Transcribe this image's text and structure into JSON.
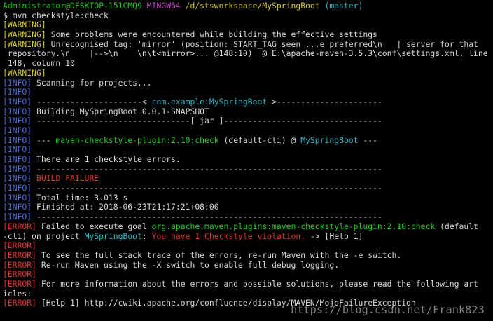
{
  "terminal": {
    "colors": {
      "background": "#000000",
      "default": "#d8d8d8",
      "green": "#1fd01f",
      "magenta": "#d04ad0",
      "yellow": "#d8c838",
      "cyan": "#30b8c8",
      "blue": "#4a6ad8",
      "red": "#e0352a"
    },
    "lines": [
      [
        [
          "green",
          "Administrator@DESKTOP-151CMQ9 "
        ],
        [
          "magenta",
          "MINGW64 "
        ],
        [
          "yellow",
          "/d/stsworkspace/MySpringBoot "
        ],
        [
          "cyan",
          "(master)"
        ]
      ],
      [
        [
          "default",
          "$ mvn checkstyle:check"
        ]
      ],
      [
        [
          "yellow",
          "[WARNING]"
        ]
      ],
      [
        [
          "yellow",
          "[WARNING]"
        ],
        [
          "default",
          " Some problems were encountered while building the effective settings"
        ]
      ],
      [
        [
          "yellow",
          "[WARNING]"
        ],
        [
          "default",
          " Unrecognised tag: 'mirror' (position: START_TAG seen ...e preferred\\n   | server for that"
        ]
      ],
      [
        [
          "default",
          " repository.\\n    |-->\\n    \\n\\t<mirror>... @148:10)  @ E:\\apache-maven-3.5.3\\conf\\settings.xml, line"
        ]
      ],
      [
        [
          "default",
          " 148, column 10"
        ]
      ],
      [
        [
          "yellow",
          "[WARNING]"
        ]
      ],
      [
        [
          "blue",
          "[INFO]"
        ],
        [
          "default",
          " Scanning for projects..."
        ]
      ],
      [
        [
          "blue",
          "[INFO]"
        ]
      ],
      [
        [
          "blue",
          "[INFO]"
        ],
        [
          "default",
          " ----------------------< "
        ],
        [
          "cyan",
          "com.example:MySpringBoot"
        ],
        [
          "default",
          " >----------------------"
        ]
      ],
      [
        [
          "blue",
          "[INFO]"
        ],
        [
          "default",
          " Building MySpringBoot 0.0.1-SNAPSHOT"
        ]
      ],
      [
        [
          "blue",
          "[INFO]"
        ],
        [
          "default",
          " --------------------------------[ jar ]---------------------------------"
        ]
      ],
      [
        [
          "blue",
          "[INFO]"
        ]
      ],
      [
        [
          "blue",
          "[INFO]"
        ],
        [
          "default",
          " --- "
        ],
        [
          "green",
          "maven-checkstyle-plugin:2.10:check"
        ],
        [
          "default",
          " (default-cli) @ "
        ],
        [
          "cyan",
          "MySpringBoot"
        ],
        [
          "default",
          " ---"
        ]
      ],
      [
        [
          "blue",
          "[INFO]"
        ]
      ],
      [
        [
          "blue",
          "[INFO]"
        ],
        [
          "default",
          " There are 1 checkstyle errors."
        ]
      ],
      [
        [
          "blue",
          "[INFO]"
        ],
        [
          "default",
          " ------------------------------------------------------------------------"
        ]
      ],
      [
        [
          "blue",
          "[INFO]"
        ],
        [
          "red",
          " BUILD FAILURE"
        ]
      ],
      [
        [
          "blue",
          "[INFO]"
        ],
        [
          "default",
          " ------------------------------------------------------------------------"
        ]
      ],
      [
        [
          "blue",
          "[INFO]"
        ],
        [
          "default",
          " Total time: 3.013 s"
        ]
      ],
      [
        [
          "blue",
          "[INFO]"
        ],
        [
          "default",
          " Finished at: 2018-06-23T21:17:21+08:00"
        ]
      ],
      [
        [
          "blue",
          "[INFO]"
        ],
        [
          "default",
          " ------------------------------------------------------------------------"
        ]
      ],
      [
        [
          "red",
          "[ERROR]"
        ],
        [
          "default",
          " Failed to execute goal "
        ],
        [
          "green",
          "org.apache.maven.plugins:maven-checkstyle-plugin:2.10:check"
        ],
        [
          "default",
          " (default"
        ]
      ],
      [
        [
          "default",
          "-cli) on project "
        ],
        [
          "cyan",
          "MySpringBoot"
        ],
        [
          "default",
          ": "
        ],
        [
          "red",
          "You have 1 Checkstyle violation."
        ],
        [
          "default",
          " -> [Help 1]"
        ]
      ],
      [
        [
          "red",
          "[ERROR]"
        ]
      ],
      [
        [
          "red",
          "[ERROR]"
        ],
        [
          "default",
          " To see the full stack trace of the errors, re-run Maven with the -e switch."
        ]
      ],
      [
        [
          "red",
          "[ERROR]"
        ],
        [
          "default",
          " Re-run Maven using the -X switch to enable full debug logging."
        ]
      ],
      [
        [
          "red",
          "[ERROR]"
        ]
      ],
      [
        [
          "red",
          "[ERROR]"
        ],
        [
          "default",
          " For more information about the errors and possible solutions, please read the following art"
        ]
      ],
      [
        [
          "default",
          "icles:"
        ]
      ],
      [
        [
          "red",
          "[ERROR]"
        ],
        [
          "default",
          " [Help 1] http://cwiki.apache.org/confluence/display/MAVEN/MojoFailureException"
        ]
      ]
    ]
  },
  "watermark": "https://blog.csdn.net/Frank823"
}
